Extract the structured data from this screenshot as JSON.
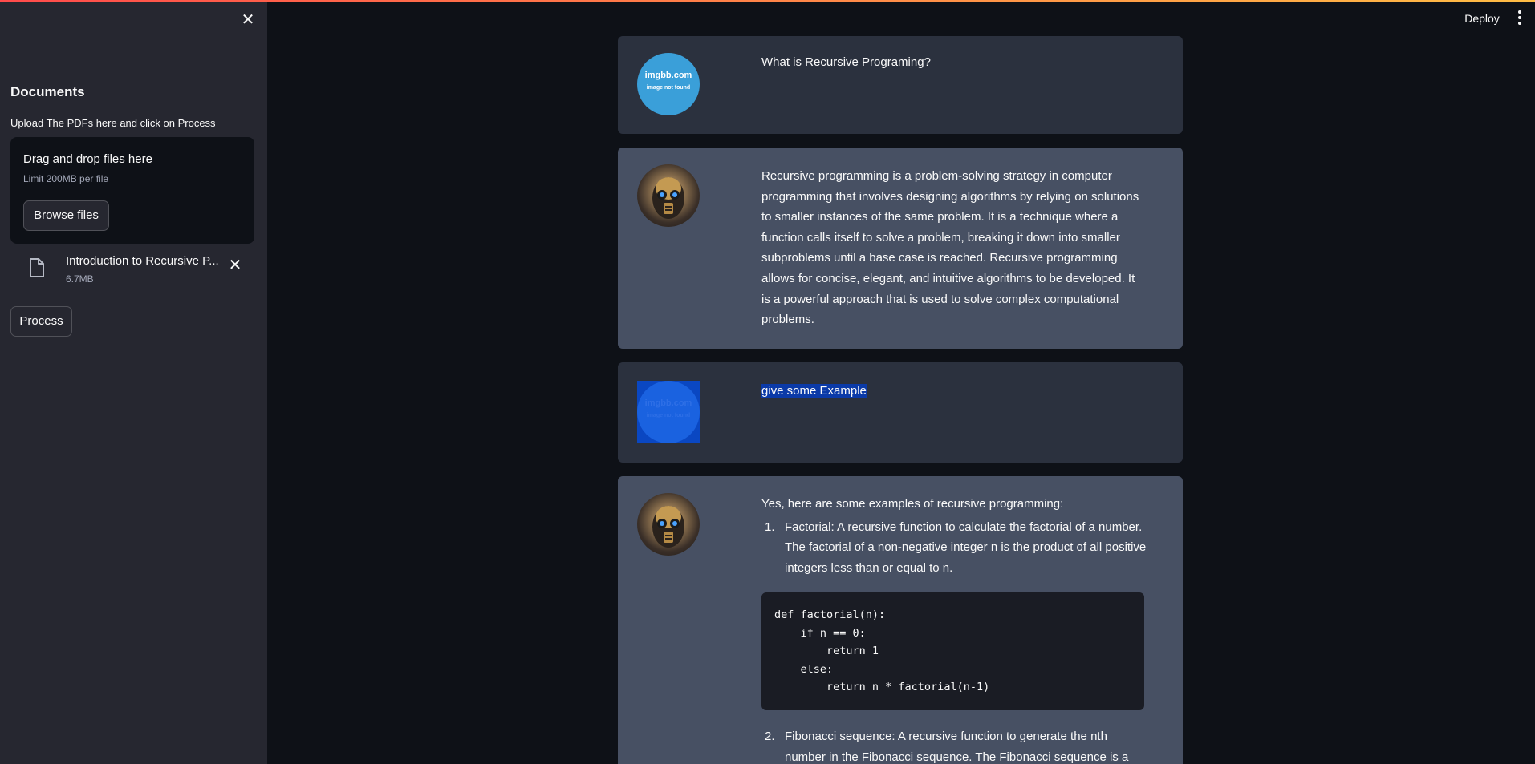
{
  "sidebar": {
    "title": "Documents",
    "caption": "Upload The PDFs here and click on Process",
    "dropzone": {
      "title": "Drag and drop files here",
      "limit": "Limit 200MB per file",
      "browse_label": "Browse files"
    },
    "file": {
      "name": "Introduction to Recursive P...",
      "size": "6.7MB"
    },
    "process_label": "Process"
  },
  "header": {
    "deploy_label": "Deploy"
  },
  "messages": [
    {
      "role": "user",
      "avatar_site": "imgbb.com",
      "avatar_note": "image not found",
      "text": "What is Recursive Programing?"
    },
    {
      "role": "bot",
      "text": "Recursive programming is a problem-solving strategy in computer programming that involves designing algorithms by relying on solutions to smaller instances of the same problem. It is a technique where a function calls itself to solve a problem, breaking it down into smaller subproblems until a base case is reached. Recursive programming allows for concise, elegant, and intuitive algorithms to be developed. It is a powerful approach that is used to solve complex computational problems."
    },
    {
      "role": "user",
      "avatar_site": "imgbb.com",
      "avatar_note": "image not found",
      "text": "give some Example"
    },
    {
      "role": "bot",
      "intro": "Yes, here are some examples of recursive programming:",
      "items": [
        {
          "num": "1.",
          "text": "Factorial: A recursive function to calculate the factorial of a number. The factorial of a non-negative integer n is the product of all positive integers less than or equal to n.",
          "code": "def factorial(n):\n    if n == 0:\n        return 1\n    else:\n        return n * factorial(n-1)"
        },
        {
          "num": "2.",
          "text": "Fibonacci sequence: A recursive function to generate the nth number in the Fibonacci sequence. The Fibonacci sequence is a"
        }
      ]
    }
  ],
  "colors": {
    "app_bg": "#0e1117",
    "sidebar_bg": "#262730",
    "user_msg_bg": "#2b313e",
    "bot_msg_bg": "#475063",
    "accent_gradient_start": "#ff4b4b",
    "accent_gradient_end": "#ffbd45"
  }
}
